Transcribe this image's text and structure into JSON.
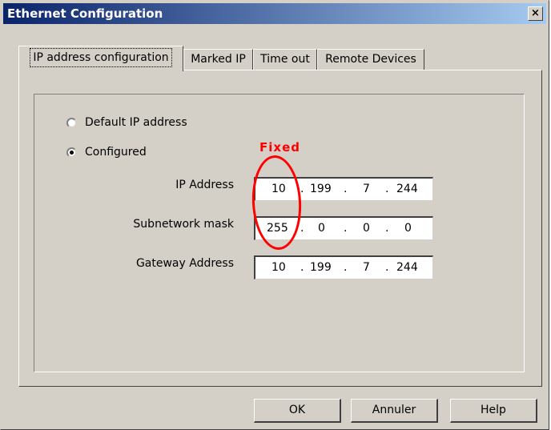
{
  "window": {
    "title": "Ethernet Configuration",
    "close_label": "×"
  },
  "tabs": [
    {
      "label": "IP address configuration",
      "active": true
    },
    {
      "label": "Marked IP",
      "active": false
    },
    {
      "label": "Time out",
      "active": false
    },
    {
      "label": "Remote Devices",
      "active": false
    }
  ],
  "options": {
    "default_ip": {
      "label": "Default IP address",
      "selected": false
    },
    "configured": {
      "label": "Configured",
      "selected": true
    }
  },
  "fields": {
    "ip_address": {
      "label": "IP Address",
      "octets": [
        "10",
        "199",
        "7",
        "244"
      ]
    },
    "subnet_mask": {
      "label": "Subnetwork mask",
      "octets": [
        "255",
        "0",
        "0",
        "0"
      ]
    },
    "gateway": {
      "label": "Gateway Address",
      "octets": [
        "10",
        "199",
        "7",
        "244"
      ]
    }
  },
  "separator": ".",
  "annotation": {
    "text": "Fixed",
    "color": "#ff0000"
  },
  "buttons": {
    "ok": "OK",
    "cancel": "Annuler",
    "help": "Help"
  },
  "colors": {
    "titlebar_start": "#0a246a",
    "titlebar_end": "#a6caf0",
    "face": "#d4d0c8"
  }
}
